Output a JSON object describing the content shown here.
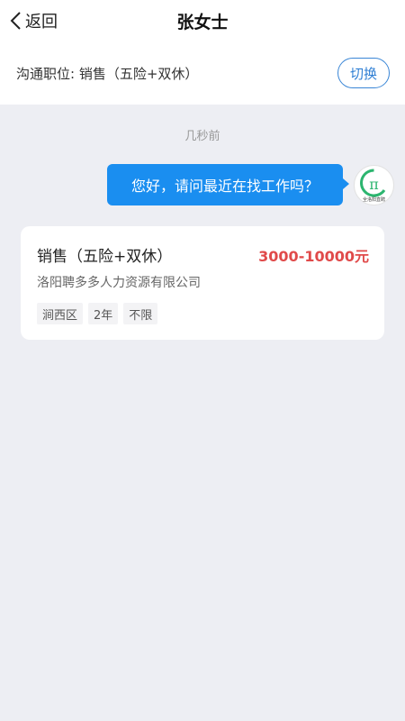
{
  "header": {
    "back_label": "返回",
    "title": "张女士"
  },
  "position_bar": {
    "text": "沟通职位: 销售（五险+双休）",
    "switch_label": "切换"
  },
  "chat": {
    "timestamp": "几秒前",
    "messages": [
      {
        "text": "您好，请问最近在找工作吗？",
        "from": "self"
      }
    ],
    "avatar_icon": "company-logo-icon",
    "avatar_logo_text": "全洛阳直聘"
  },
  "job_card": {
    "title": "销售（五险+双休）",
    "salary": "3000-10000元",
    "company": "洛阳聘多多人力资源有限公司",
    "tags": [
      "涧西区",
      "2年",
      "不限"
    ]
  },
  "colors": {
    "accent": "#1a8ef0",
    "switch_border": "#3a86d6",
    "salary": "#e04a4a",
    "background": "#edeef3",
    "logo_green": "#2cb56f"
  }
}
